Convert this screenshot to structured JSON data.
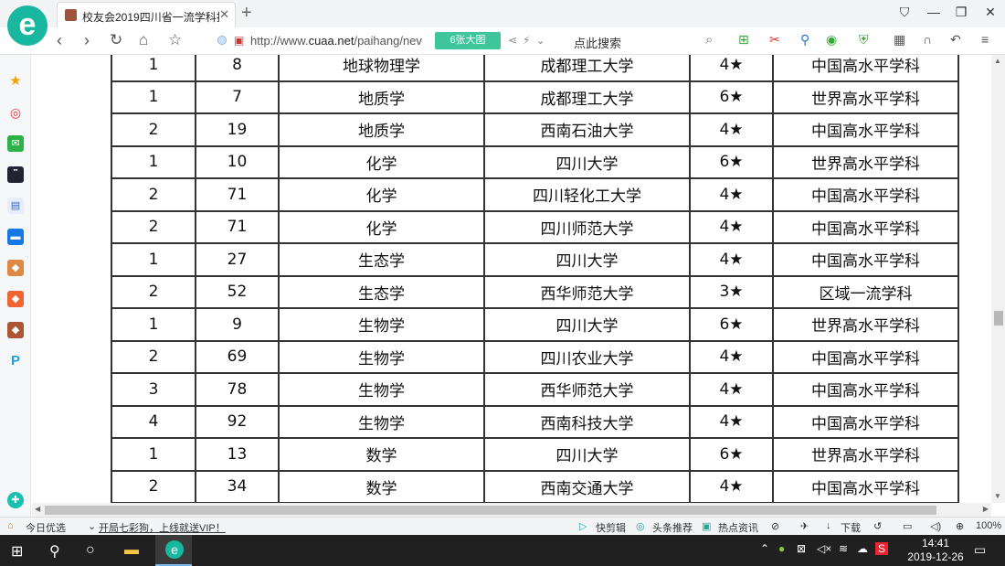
{
  "browser": {
    "tab_title": "校友会2019四川省一流学科排名",
    "url_prefix": "http://www.",
    "url_domain": "cuaa.net",
    "url_rest": "/paihang/nev",
    "image_badge": "6张大图",
    "search_placeholder": "点此搜索"
  },
  "table": {
    "rows": [
      [
        "1",
        "8",
        "地球物理学",
        "成都理工大学",
        "4★",
        "中国高水平学科"
      ],
      [
        "1",
        "7",
        "地质学",
        "成都理工大学",
        "6★",
        "世界高水平学科"
      ],
      [
        "2",
        "19",
        "地质学",
        "西南石油大学",
        "4★",
        "中国高水平学科"
      ],
      [
        "1",
        "10",
        "化学",
        "四川大学",
        "6★",
        "世界高水平学科"
      ],
      [
        "2",
        "71",
        "化学",
        "四川轻化工大学",
        "4★",
        "中国高水平学科"
      ],
      [
        "2",
        "71",
        "化学",
        "四川师范大学",
        "4★",
        "中国高水平学科"
      ],
      [
        "1",
        "27",
        "生态学",
        "四川大学",
        "4★",
        "中国高水平学科"
      ],
      [
        "2",
        "52",
        "生态学",
        "西华师范大学",
        "3★",
        "区域一流学科"
      ],
      [
        "1",
        "9",
        "生物学",
        "四川大学",
        "6★",
        "世界高水平学科"
      ],
      [
        "2",
        "69",
        "生物学",
        "四川农业大学",
        "4★",
        "中国高水平学科"
      ],
      [
        "3",
        "78",
        "生物学",
        "西华师范大学",
        "4★",
        "中国高水平学科"
      ],
      [
        "4",
        "92",
        "生物学",
        "西南科技大学",
        "4★",
        "中国高水平学科"
      ],
      [
        "1",
        "13",
        "数学",
        "四川大学",
        "6★",
        "世界高水平学科"
      ],
      [
        "2",
        "34",
        "数学",
        "西南交通大学",
        "4★",
        "中国高水平学科"
      ]
    ]
  },
  "statusbar": {
    "left_news": "今日优选",
    "promo": "开局七彩狗，上线就送VIP！",
    "items": [
      "快剪辑",
      "头条推荐",
      "热点资讯",
      "下载"
    ],
    "zoom": "100%"
  },
  "taskbar": {
    "time": "14:41",
    "date": "2019-12-26"
  },
  "colors": {
    "logo": "#18b8a0",
    "badge": "#3fc59a"
  }
}
